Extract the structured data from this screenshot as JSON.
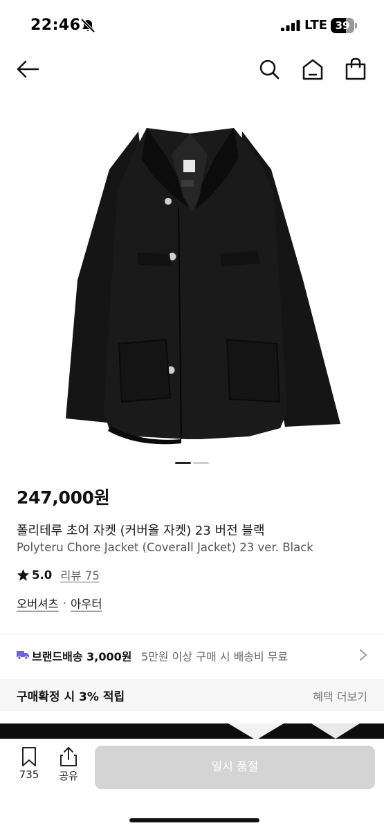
{
  "status_bar": {
    "time": "22:46",
    "network": "LTE",
    "battery": "39",
    "icons": [
      "bell-slash-icon",
      "signal-icon"
    ]
  },
  "nav": {
    "icons": [
      "back-arrow-icon",
      "search-icon",
      "home-icon",
      "shopping-bag-icon"
    ]
  },
  "product": {
    "image_subject": "black-chore-jacket",
    "carousel": {
      "count": 2,
      "active_index": 0
    },
    "price": "247,000원",
    "title_ko": "폴리테루 초어 자켓 (커버올 자켓) 23 버전 블랙",
    "title_en": "Polyteru Chore Jacket (Coverall Jacket) 23 ver. Black",
    "rating": "5.0",
    "review_label": "리뷰 75",
    "categories": [
      "오버셔츠",
      "아우터"
    ],
    "category_separator": "·"
  },
  "shipping": {
    "brand_label": "브랜드배송 3,000원",
    "condition": "5만원 이상 구매 시 배송비 무료",
    "icon": "truck-icon",
    "accent_color": "#6b63d9"
  },
  "reward": {
    "text": "구매확정 시 3% 적립",
    "link": "혜택 더보기"
  },
  "bottom_bar": {
    "save_count": "735",
    "share_label": "공유",
    "buy_button_label": "일시 품절",
    "buy_button_color": "#d4d4d4"
  }
}
